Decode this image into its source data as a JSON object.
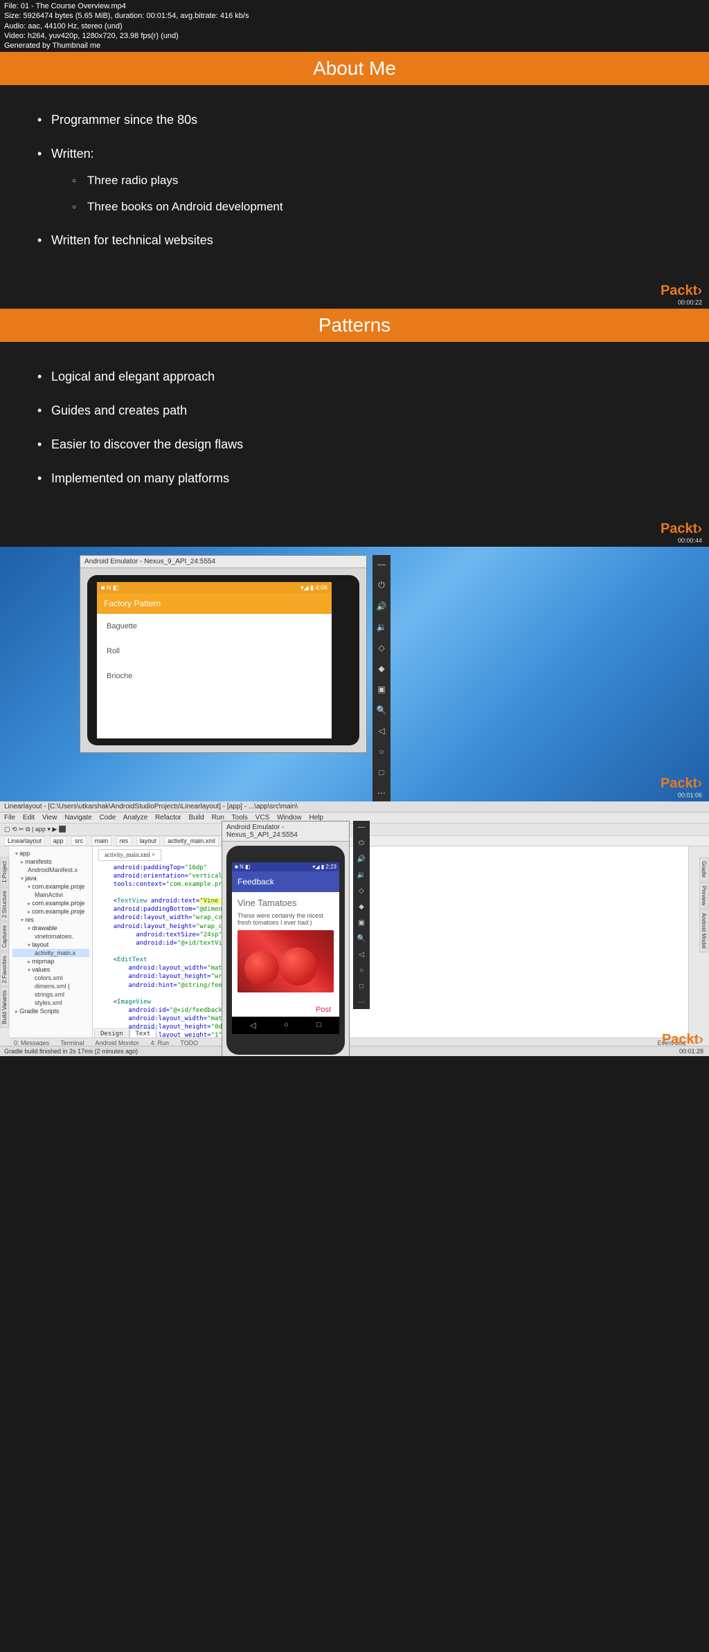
{
  "meta": {
    "file": "File: 01 - The Course Overview.mp4",
    "size": "Size: 5926474 bytes (5.65 MiB), duration: 00:01:54, avg.bitrate: 416 kb/s",
    "audio": "Audio: aac, 44100 Hz, stereo (und)",
    "video": "Video: h264, yuv420p, 1280x720, 23.98 fps(r) (und)",
    "gen": "Generated by Thumbnail me"
  },
  "slide1": {
    "title": "About Me",
    "items": {
      "i0": "Programmer since the 80s",
      "i1": "Written:",
      "sub0": "Three radio plays",
      "sub1": "Three books on Android development",
      "i2": "Written for technical websites"
    },
    "brand": "Packt",
    "ts": "00:00:22"
  },
  "slide2": {
    "title": "Patterns",
    "items": {
      "i0": "Logical and elegant approach",
      "i1": "Guides and creates path",
      "i2": "Easier to discover the design flaws",
      "i3": "Implemented on many platforms"
    },
    "brand": "Packt",
    "ts": "00:00:44"
  },
  "shot3": {
    "emu_title": "Android Emulator - Nexus_9_API_24:5554",
    "time": "4:06",
    "sysicons": "■ N ◧",
    "appbar": "Factory Pattern",
    "list": {
      "i0": "Baguette",
      "i1": "Roll",
      "i2": "Brioche"
    },
    "brand": "Packt",
    "ts": "00:01:06"
  },
  "shot4": {
    "ide_title": "Linearlayout - [C:\\Users\\utkarshak\\AndroidStudioProjects\\Linearlayout] - [app] - ...\\app\\src\\main\\",
    "menu": {
      "file": "File",
      "edit": "Edit",
      "view": "View",
      "nav": "Navigate",
      "code": "Code",
      "analyze": "Analyze",
      "refactor": "Refactor",
      "build": "Build",
      "run": "Run",
      "tools": "Tools",
      "vcs": "VCS",
      "window": "Window",
      "help": "Help"
    },
    "crumbs": {
      "c0": "Linearlayout",
      "c1": "app",
      "c2": "src",
      "c3": "main",
      "c4": "res",
      "c5": "layout",
      "c6": "activity_main.xml"
    },
    "tree": {
      "app": "app",
      "manifests": "manifests",
      "androidmanifest": "AndroidManifest.x",
      "java": "java",
      "pkg1": "com.example.proje",
      "main": "MainActivi",
      "pkg2": "com.example.proje",
      "pkg3": "com.example.proje",
      "res": "res",
      "drawable": "drawable",
      "vinetomatoes": "vinetomatoes.",
      "layout": "layout",
      "activitymain": "activity_main.x",
      "mipmap": "mipmap",
      "values": "values",
      "colors": "colors.xml",
      "dimens": "dimens.xml (",
      "strings": "strings.xml",
      "styles": "styles.xml",
      "gradle": "Gradle Scripts"
    },
    "editor_tab": "activity_main.xml ×",
    "emu_title": "Android Emulator - Nexus_5_API_24:5554",
    "emu_time": "2:23",
    "emu_sysicons": "■ N ◧",
    "emu_appbar": "Feedback",
    "emu_heading": "Vine Tamatoes",
    "emu_text": "These were certainly the nicest fresh tomatoes I ever had:)",
    "emu_post": "Post",
    "design_tab": "Design",
    "text_tab": "Text",
    "bottom": {
      "msgs": "0: Messages",
      "terminal": "Terminal",
      "monitor": "Android Monitor",
      "run": "4: Run",
      "todo": "TODO",
      "eventlog": "Event Log"
    },
    "status": "Gradle build finished in 2s 17ms (2 minutes ago)",
    "brand": "Packt",
    "ts": "00:01:28"
  }
}
